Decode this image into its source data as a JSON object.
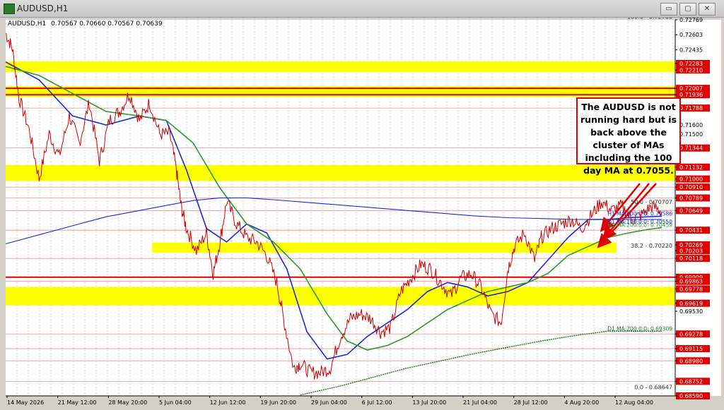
{
  "window": {
    "title": "AUDUSD,H1",
    "buttons": [
      "▭",
      "▢",
      "✕"
    ]
  },
  "chart_header": {
    "symbol": "AUDUSD,H1",
    "ohlc": "0.70567 0.70660 0.70567 0.70639"
  },
  "annotation": {
    "text": "The AUDUSD is not running hard but is back above the cluster of MAs including the 100 day MA at 0.7055."
  },
  "colors": {
    "background": "#ffffff",
    "price": "#cc0000",
    "ma100": "#1a2bd6",
    "ma200": "#2a9a2a",
    "d1ma": "#1f7a1f",
    "zone": "#ffff00",
    "redline": "#e00000"
  },
  "chart_data": {
    "type": "line",
    "title": "AUDUSD,H1",
    "ylim": [
      0.6859,
      0.72769
    ],
    "x_ticks": [
      "14 May 2026",
      "21 May 12:00",
      "28 May 20:00",
      "5 Jun 04:00",
      "12 Jun 12:00",
      "19 Jun 20:00",
      "29 Jun 04:00",
      "6 Jul 12:00",
      "13 Jul 20:00",
      "21 Jul 04:00",
      "28 Jul 12:00",
      "4 Aug 20:00",
      "12 Aug 04:00"
    ],
    "y_ticks": [
      "0.72769",
      "0.72603",
      "0.72435",
      "0.72283",
      "0.72210",
      "0.72007",
      "0.71936",
      "0.71788",
      "0.71600",
      "0.71500",
      "0.71344",
      "0.71132",
      "0.71000",
      "0.70910",
      "0.70789",
      "0.70649",
      "0.70431",
      "0.70269",
      "0.70203",
      "0.70118",
      "0.69909",
      "0.69863",
      "0.69778",
      "0.69619",
      "0.69530",
      "0.69278",
      "0.69115",
      "0.68980",
      "0.68752",
      "0.68590"
    ],
    "zones": [
      {
        "from": 0.7221,
        "to": 0.72283
      },
      {
        "from": 0.71936,
        "to": 0.72007
      },
      {
        "from": 0.71,
        "to": 0.71132
      },
      {
        "from": 0.70203,
        "to": 0.70269
      },
      {
        "from": 0.69619,
        "to": 0.69778
      }
    ],
    "red_lines": [
      0.72007,
      0.71936,
      0.69909
    ],
    "gridlines": [
      0.71788,
      0.71344,
      0.7091,
      0.70789,
      0.70649,
      0.70431,
      0.70118,
      0.69863,
      0.69278,
      0.69115,
      0.6898,
      0.68752
    ],
    "levels": [
      {
        "label": "100.0 - 0.72766",
        "value": 0.72766
      },
      {
        "label": "50.0 - 0.70707",
        "value": 0.70707
      },
      {
        "label": "38.2 - 0.70220",
        "value": 0.7022
      },
      {
        "label": "0.0 - 0.68647",
        "value": 0.68647
      }
    ],
    "ma_labels": [
      {
        "label": "H1 MA:100:0:0: 0.70586",
        "value": 0.70586,
        "color": "#1a2bd6"
      },
      {
        "label": "D1 MA:100:0:0: 0.70550",
        "value": 0.7055,
        "color": "#1a2bd6"
      },
      {
        "label": "H1 MA:200:0:0: 0.70459",
        "value": 0.70459,
        "color": "#2a9a2a"
      },
      {
        "label": "D1 MA:200:0:0: 0.69309",
        "value": 0.69309,
        "color": "#1f7a1f"
      }
    ],
    "price_path": [
      [
        0,
        0.7262
      ],
      [
        0.01,
        0.7245
      ],
      [
        0.02,
        0.719
      ],
      [
        0.035,
        0.7155
      ],
      [
        0.05,
        0.71
      ],
      [
        0.065,
        0.715
      ],
      [
        0.08,
        0.7125
      ],
      [
        0.095,
        0.717
      ],
      [
        0.11,
        0.714
      ],
      [
        0.125,
        0.7185
      ],
      [
        0.14,
        0.712
      ],
      [
        0.155,
        0.7165
      ],
      [
        0.17,
        0.7175
      ],
      [
        0.185,
        0.7195
      ],
      [
        0.2,
        0.7165
      ],
      [
        0.215,
        0.7185
      ],
      [
        0.23,
        0.715
      ],
      [
        0.245,
        0.715
      ],
      [
        0.255,
        0.711
      ],
      [
        0.262,
        0.707
      ],
      [
        0.27,
        0.7045
      ],
      [
        0.285,
        0.702
      ],
      [
        0.3,
        0.704
      ],
      [
        0.31,
        0.6995
      ],
      [
        0.32,
        0.703
      ],
      [
        0.33,
        0.7075
      ],
      [
        0.345,
        0.705
      ],
      [
        0.36,
        0.7035
      ],
      [
        0.375,
        0.703
      ],
      [
        0.39,
        0.7015
      ],
      [
        0.405,
        0.6985
      ],
      [
        0.415,
        0.6945
      ],
      [
        0.43,
        0.689
      ],
      [
        0.44,
        0.6895
      ],
      [
        0.455,
        0.6885
      ],
      [
        0.47,
        0.6885
      ],
      [
        0.485,
        0.689
      ],
      [
        0.5,
        0.6925
      ],
      [
        0.515,
        0.6945
      ],
      [
        0.53,
        0.695
      ],
      [
        0.545,
        0.6945
      ],
      [
        0.56,
        0.693
      ],
      [
        0.575,
        0.6935
      ],
      [
        0.59,
        0.6975
      ],
      [
        0.605,
        0.699
      ],
      [
        0.62,
        0.7005
      ],
      [
        0.635,
        0.7
      ],
      [
        0.65,
        0.6985
      ],
      [
        0.665,
        0.697
      ],
      [
        0.68,
        0.699
      ],
      [
        0.695,
        0.6995
      ],
      [
        0.71,
        0.698
      ],
      [
        0.725,
        0.695
      ],
      [
        0.74,
        0.694
      ],
      [
        0.75,
        0.7
      ],
      [
        0.76,
        0.7025
      ],
      [
        0.775,
        0.704
      ],
      [
        0.79,
        0.701
      ],
      [
        0.8,
        0.7035
      ],
      [
        0.815,
        0.7045
      ],
      [
        0.83,
        0.705
      ],
      [
        0.845,
        0.7055
      ],
      [
        0.86,
        0.7045
      ],
      [
        0.875,
        0.706
      ],
      [
        0.89,
        0.7075
      ],
      [
        0.905,
        0.7065
      ],
      [
        0.92,
        0.707
      ],
      [
        0.935,
        0.7055
      ],
      [
        0.95,
        0.706
      ],
      [
        0.965,
        0.707
      ],
      [
        0.98,
        0.7064
      ]
    ],
    "series": [
      {
        "name": "H1 MA:100",
        "points": [
          [
            0,
            0.723
          ],
          [
            0.05,
            0.721
          ],
          [
            0.1,
            0.717
          ],
          [
            0.15,
            0.716
          ],
          [
            0.2,
            0.717
          ],
          [
            0.24,
            0.7165
          ],
          [
            0.27,
            0.711
          ],
          [
            0.3,
            0.7045
          ],
          [
            0.33,
            0.703
          ],
          [
            0.36,
            0.705
          ],
          [
            0.39,
            0.704
          ],
          [
            0.42,
            0.7
          ],
          [
            0.45,
            0.693
          ],
          [
            0.48,
            0.69
          ],
          [
            0.51,
            0.6905
          ],
          [
            0.54,
            0.6925
          ],
          [
            0.57,
            0.694
          ],
          [
            0.6,
            0.6955
          ],
          [
            0.63,
            0.6975
          ],
          [
            0.66,
            0.6985
          ],
          [
            0.69,
            0.698
          ],
          [
            0.72,
            0.697
          ],
          [
            0.75,
            0.6975
          ],
          [
            0.78,
            0.6985
          ],
          [
            0.81,
            0.701
          ],
          [
            0.84,
            0.7035
          ],
          [
            0.87,
            0.7055
          ],
          [
            0.9,
            0.7055
          ],
          [
            0.93,
            0.7057
          ],
          [
            0.96,
            0.7058
          ],
          [
            0.98,
            0.70586
          ]
        ]
      },
      {
        "name": "H1 MA:200",
        "points": [
          [
            0,
            0.7225
          ],
          [
            0.05,
            0.7215
          ],
          [
            0.1,
            0.7195
          ],
          [
            0.15,
            0.7175
          ],
          [
            0.2,
            0.717
          ],
          [
            0.24,
            0.7165
          ],
          [
            0.28,
            0.714
          ],
          [
            0.32,
            0.709
          ],
          [
            0.36,
            0.705
          ],
          [
            0.4,
            0.703
          ],
          [
            0.44,
            0.7
          ],
          [
            0.48,
            0.695
          ],
          [
            0.51,
            0.692
          ],
          [
            0.54,
            0.691
          ],
          [
            0.57,
            0.6915
          ],
          [
            0.6,
            0.6925
          ],
          [
            0.63,
            0.694
          ],
          [
            0.66,
            0.6955
          ],
          [
            0.69,
            0.6965
          ],
          [
            0.72,
            0.6975
          ],
          [
            0.75,
            0.698
          ],
          [
            0.78,
            0.6985
          ],
          [
            0.81,
            0.6995
          ],
          [
            0.84,
            0.7015
          ],
          [
            0.87,
            0.7025
          ],
          [
            0.9,
            0.7035
          ],
          [
            0.93,
            0.704
          ],
          [
            0.96,
            0.7044
          ],
          [
            0.98,
            0.70459
          ]
        ]
      },
      {
        "name": "D1 MA:100",
        "points": [
          [
            0,
            0.7028
          ],
          [
            0.05,
            0.7038
          ],
          [
            0.1,
            0.7048
          ],
          [
            0.15,
            0.7058
          ],
          [
            0.2,
            0.7065
          ],
          [
            0.25,
            0.7072
          ],
          [
            0.28,
            0.7076
          ],
          [
            0.32,
            0.7079
          ],
          [
            0.36,
            0.7079
          ],
          [
            0.4,
            0.7077
          ],
          [
            0.45,
            0.7074
          ],
          [
            0.5,
            0.7071
          ],
          [
            0.55,
            0.7068
          ],
          [
            0.6,
            0.7065
          ],
          [
            0.65,
            0.7062
          ],
          [
            0.7,
            0.7059
          ],
          [
            0.75,
            0.7057
          ],
          [
            0.8,
            0.7056
          ],
          [
            0.85,
            0.7055
          ],
          [
            0.9,
            0.7055
          ],
          [
            0.95,
            0.7055
          ],
          [
            0.98,
            0.7055
          ]
        ]
      },
      {
        "name": "D1 MA:200",
        "points": [
          [
            0.44,
            0.686
          ],
          [
            0.5,
            0.687
          ],
          [
            0.55,
            0.688
          ],
          [
            0.6,
            0.689
          ],
          [
            0.65,
            0.6898
          ],
          [
            0.7,
            0.6906
          ],
          [
            0.75,
            0.6913
          ],
          [
            0.8,
            0.692
          ],
          [
            0.85,
            0.6926
          ],
          [
            0.9,
            0.6931
          ],
          [
            0.98,
            0.69309
          ]
        ]
      }
    ]
  }
}
